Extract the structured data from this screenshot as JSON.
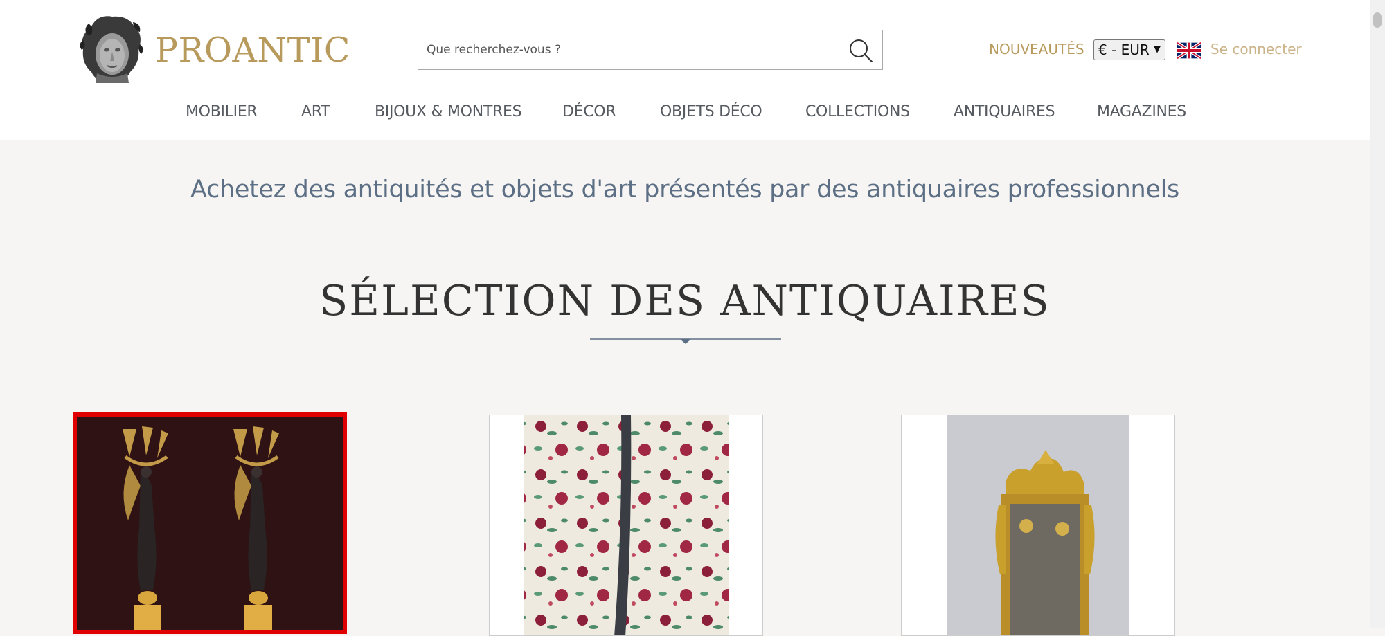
{
  "header": {
    "brand": "PROANTIC",
    "search_placeholder": "Que recherchez-vous ?",
    "nouveautes": "NOUVEAUTÉS",
    "currency": "€ - EUR",
    "login": "Se connecter"
  },
  "nav": [
    "MOBILIER",
    "ART",
    "BIJOUX & MONTRES",
    "DÉCOR",
    "OBJETS DÉCO",
    "COLLECTIONS",
    "ANTIQUAIRES",
    "MAGAZINES"
  ],
  "main": {
    "tagline": "Achetez des antiquités et objets d'art présentés par des antiquaires professionnels",
    "section_title": "SÉLECTION DES ANTIQUAIRES"
  },
  "colors": {
    "brand_gold": "#b79a5c",
    "tagline_blue": "#5c6f85",
    "selected_border": "#e00000"
  }
}
